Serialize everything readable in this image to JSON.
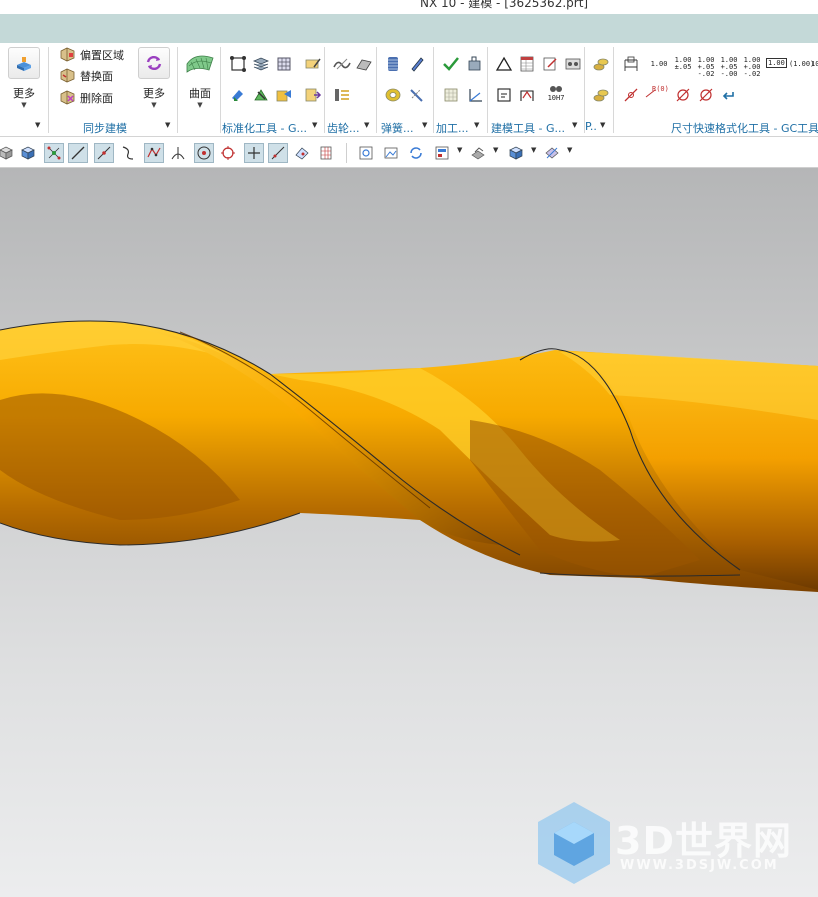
{
  "window": {
    "title": "NX 10 - 建模 - [3625362.prt]"
  },
  "ribbon": {
    "more_left_label": "更多",
    "sync": {
      "items": [
        "偏置区域",
        "替换面",
        "删除面"
      ],
      "more_label": "更多",
      "group_label": "同步建模"
    },
    "surface": {
      "label": "曲面"
    },
    "groups": {
      "standard_tools": "标准化工具 - G...",
      "gear": "齿轮...",
      "spring": "弹簧...",
      "machining": "加工...",
      "modeling_tools": "建模工具 - G...",
      "short": "P...",
      "dimension_tools": "尺寸快速格式化工具 - GC工具"
    },
    "dimension_formats": {
      "f1": "1.00",
      "f2_top": "1.00",
      "f2_bot": "±.05",
      "f3_top": "1.00",
      "f3_bot": "+.05\n-.02",
      "f4_top": "1.00",
      "f4_bot": "+.05\n-.00",
      "f5_top": "1.00",
      "f5_bot": "+.00\n-.02",
      "f6": "1.00",
      "f7": "(1.00)",
      "f8": "10",
      "fit": "10H7",
      "r_label": "R(0)"
    }
  },
  "viewport": {
    "model_color": "#f6a800",
    "background_top": "#b5b6b7",
    "background_bottom": "#ecedee"
  },
  "watermark": {
    "main": "3D世界网",
    "sub": "WWW.3DSJW.COM"
  },
  "icons": [
    "block-icon",
    "offset-region-icon",
    "replace-face-icon",
    "delete-face-icon",
    "sync-more-icon",
    "surface-icon",
    "view-icon",
    "snap-icon",
    "select-icon",
    "curve-icon",
    "point-icon",
    "circle-icon",
    "refresh-icon"
  ]
}
